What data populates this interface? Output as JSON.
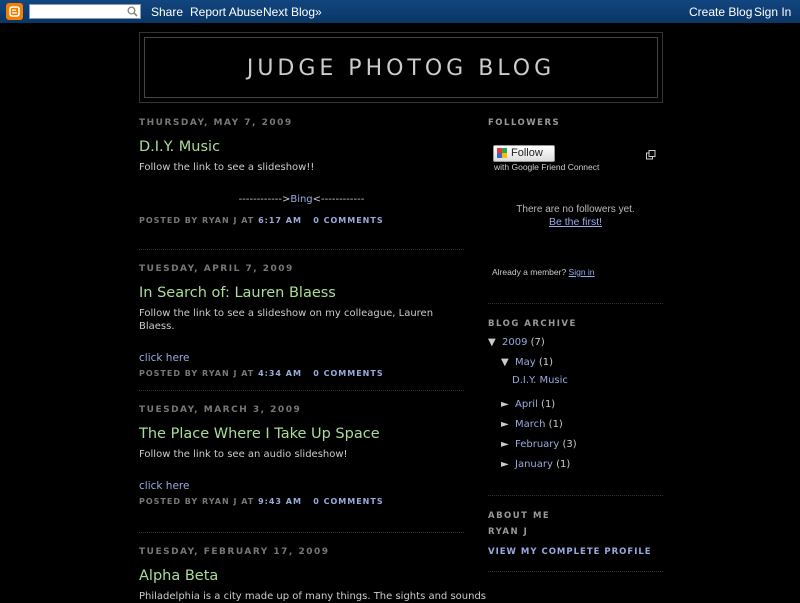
{
  "navbar": {
    "search_placeholder": "",
    "share": "Share",
    "report_abuse": "Report Abuse",
    "next_blog": "Next Blog»",
    "create_blog": "Create Blog",
    "sign_in": "Sign In",
    "colors": {
      "bar": "#0a3a73",
      "logo": "#f57d00"
    }
  },
  "header": {
    "title": "JUDGE PHOTOG BLOG"
  },
  "posts": [
    {
      "date": "Thursday, May 7, 2009",
      "title": "D.I.Y. Music",
      "body": "Follow the link to see a slideshow!!",
      "link_left": "------------>",
      "link_text": "Bing",
      "link_right": "<------------",
      "posted_by": "Posted by",
      "author": "Ryan J",
      "at": "at",
      "time": "6:17 AM",
      "comments": "0 comments"
    },
    {
      "date": "Tuesday, April 7, 2009",
      "title": "In Search of: Lauren Blaess",
      "body": "Follow the link to see a slideshow on my colleague, Lauren Blaess.",
      "link": "click here",
      "posted_by": "Posted by",
      "author": "Ryan J",
      "at": "at",
      "time": "4:34 AM",
      "comments": "0 comments"
    },
    {
      "date": "Tuesday, March 3, 2009",
      "title": "The Place Where I Take Up Space",
      "body": "Follow the link to see an audio slideshow!",
      "link": "click here",
      "posted_by": "Posted by",
      "author": "Ryan J",
      "at": "at",
      "time": "9:43 AM",
      "comments": "0 comments"
    },
    {
      "date": "Tuesday, February 17, 2009",
      "title": "Alpha Beta",
      "body": "Philadelphia is a city made up of many things. The sights and sounds"
    }
  ],
  "sidebar": {
    "followers": {
      "heading": "Followers",
      "follow_label": "Follow",
      "gfc_sub": "with Google Friend Connect",
      "no_followers": "There are no followers yet.",
      "be_first": "Be the first!",
      "already_member": "Already a member?",
      "sign_in": "Sign in"
    },
    "archive": {
      "heading": "Blog Archive",
      "year": "2009",
      "year_count": "(7)",
      "months": [
        {
          "name": "May",
          "count": "(1)",
          "expanded": true,
          "posts": [
            "D.I.Y. Music"
          ]
        },
        {
          "name": "April",
          "count": "(1)",
          "expanded": false
        },
        {
          "name": "March",
          "count": "(1)",
          "expanded": false
        },
        {
          "name": "February",
          "count": "(3)",
          "expanded": false
        },
        {
          "name": "January",
          "count": "(1)",
          "expanded": false
        }
      ]
    },
    "about": {
      "heading": "About Me",
      "name": "Ryan J",
      "profile_link": "View my complete profile"
    }
  }
}
